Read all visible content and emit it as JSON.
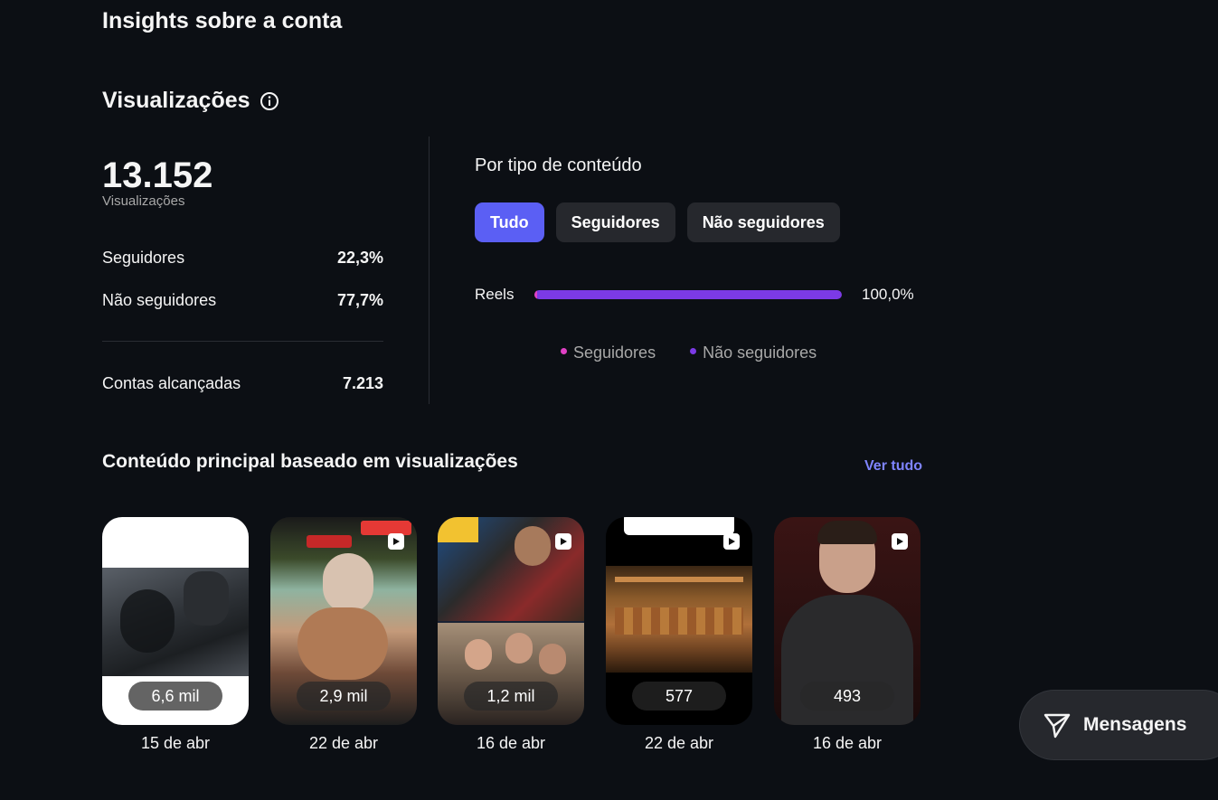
{
  "page": {
    "title": "Insights sobre a conta"
  },
  "views": {
    "heading": "Visualizações",
    "total": "13.152",
    "total_label": "Visualizações",
    "followers_label": "Seguidores",
    "followers_value": "22,3%",
    "non_followers_label": "Não seguidores",
    "non_followers_value": "77,7%",
    "reached_label": "Contas alcançadas",
    "reached_value": "7.213"
  },
  "content_type": {
    "heading": "Por tipo de conteúdo",
    "chips": [
      {
        "label": "Tudo",
        "active": true
      },
      {
        "label": "Seguidores",
        "active": false
      },
      {
        "label": "Não seguidores",
        "active": false
      }
    ],
    "bar": {
      "label": "Reels",
      "value_label": "100,0%",
      "fill_fraction": 1.0,
      "followers_fraction": 0.01
    },
    "legend": [
      {
        "label": "Seguidores",
        "color": "#e040c4"
      },
      {
        "label": "Não seguidores",
        "color": "#7c3ae6"
      }
    ]
  },
  "top_content": {
    "heading": "Conteúdo principal baseado em visualizações",
    "see_all": "Ver tudo",
    "items": [
      {
        "views": "6,6 mil",
        "date": "15 de abr"
      },
      {
        "views": "2,9 mil",
        "date": "22 de abr"
      },
      {
        "views": "1,2 mil",
        "date": "16 de abr"
      },
      {
        "views": "577",
        "date": "22 de abr"
      },
      {
        "views": "493",
        "date": "16 de abr"
      }
    ]
  },
  "messages": {
    "label": "Mensagens",
    "icon": "paper-plane-icon"
  },
  "colors": {
    "background": "#0c0f14",
    "accent": "#5b5ff4",
    "link": "#7f84ff",
    "followers": "#e040c4",
    "non_followers": "#7c3ae6"
  }
}
